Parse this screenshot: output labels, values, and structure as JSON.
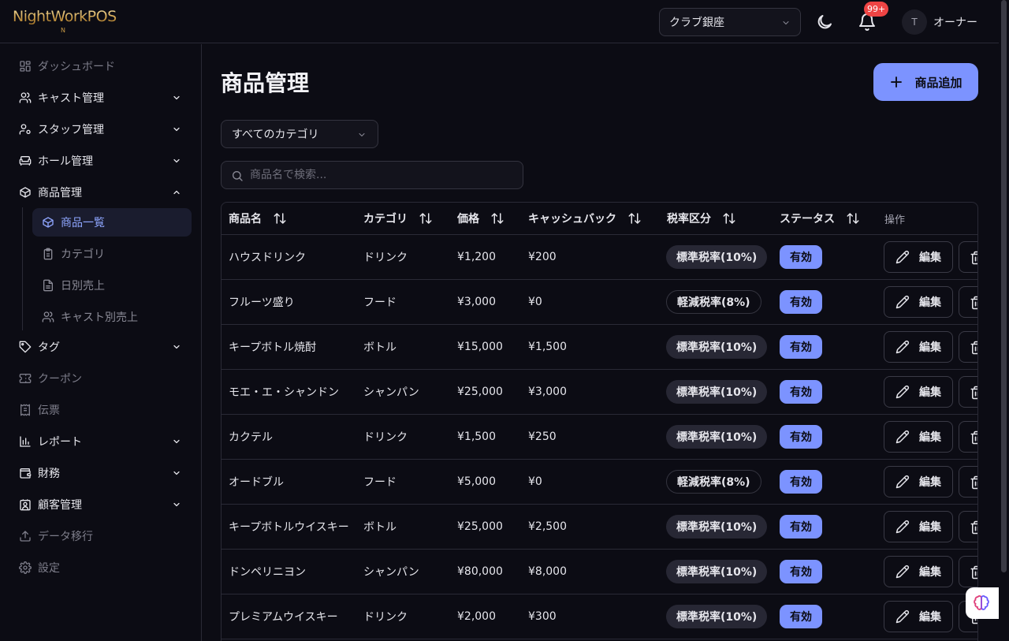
{
  "app": {
    "logo_text": "NightWorkPOS",
    "logo_mark": "N"
  },
  "header": {
    "store_select_value": "クラブ銀座",
    "notifications_badge": "99+",
    "avatar_initial": "T",
    "user_name": "オーナー"
  },
  "sidebar": {
    "items": [
      {
        "label": "ダッシュボード",
        "icon": "dashboard-icon"
      },
      {
        "label": "キャスト管理",
        "icon": "users-icon"
      },
      {
        "label": "スタッフ管理",
        "icon": "user-cog-icon"
      },
      {
        "label": "ホール管理",
        "icon": "sofa-icon"
      },
      {
        "label": "商品管理",
        "icon": "package-icon"
      },
      {
        "label": "タグ",
        "icon": "tag-icon"
      },
      {
        "label": "クーポン",
        "icon": "ticket-icon"
      },
      {
        "label": "伝票",
        "icon": "receipt-icon"
      },
      {
        "label": "レポート",
        "icon": "bar-chart-icon"
      },
      {
        "label": "財務",
        "icon": "wallet-icon"
      },
      {
        "label": "顧客管理",
        "icon": "contact-icon"
      },
      {
        "label": "データ移行",
        "icon": "upload-icon"
      },
      {
        "label": "設定",
        "icon": "gear-icon"
      }
    ],
    "sub_items": [
      {
        "label": "商品一覧",
        "icon": "package-icon"
      },
      {
        "label": "カテゴリ",
        "icon": "clipboard-icon"
      },
      {
        "label": "日別売上",
        "icon": "file-icon"
      },
      {
        "label": "キャスト別売上",
        "icon": "users-icon"
      }
    ]
  },
  "main": {
    "title": "商品管理",
    "add_button": "商品追加",
    "category_filter": "すべてのカテゴリ",
    "search_placeholder": "商品名で検索...",
    "columns": [
      "商品名",
      "カテゴリ",
      "価格",
      "キャッシュバック",
      "税率区分",
      "ステータス",
      "操作"
    ],
    "edit_label": "編集",
    "rows": [
      {
        "name": "ハウスドリンク",
        "category": "ドリンク",
        "price": "¥1,200",
        "cashback": "¥200",
        "tax": "標準税率(10%)",
        "tax_kind": "standard",
        "status": "有効"
      },
      {
        "name": "フルーツ盛り",
        "category": "フード",
        "price": "¥3,000",
        "cashback": "¥0",
        "tax": "軽減税率(8%)",
        "tax_kind": "reduced",
        "status": "有効"
      },
      {
        "name": "キープボトル焼酎",
        "category": "ボトル",
        "price": "¥15,000",
        "cashback": "¥1,500",
        "tax": "標準税率(10%)",
        "tax_kind": "standard",
        "status": "有効"
      },
      {
        "name": "モエ・エ・シャンドン",
        "category": "シャンパン",
        "price": "¥25,000",
        "cashback": "¥3,000",
        "tax": "標準税率(10%)",
        "tax_kind": "standard",
        "status": "有効"
      },
      {
        "name": "カクテル",
        "category": "ドリンク",
        "price": "¥1,500",
        "cashback": "¥250",
        "tax": "標準税率(10%)",
        "tax_kind": "standard",
        "status": "有効"
      },
      {
        "name": "オードブル",
        "category": "フード",
        "price": "¥5,000",
        "cashback": "¥0",
        "tax": "軽減税率(8%)",
        "tax_kind": "reduced",
        "status": "有効"
      },
      {
        "name": "キープボトルウイスキー",
        "category": "ボトル",
        "price": "¥25,000",
        "cashback": "¥2,500",
        "tax": "標準税率(10%)",
        "tax_kind": "standard",
        "status": "有効"
      },
      {
        "name": "ドンペリニヨン",
        "category": "シャンパン",
        "price": "¥80,000",
        "cashback": "¥8,000",
        "tax": "標準税率(10%)",
        "tax_kind": "standard",
        "status": "有効"
      },
      {
        "name": "プレミアムウイスキー",
        "category": "ドリンク",
        "price": "¥2,000",
        "cashback": "¥300",
        "tax": "標準税率(10%)",
        "tax_kind": "standard",
        "status": "有効"
      }
    ]
  },
  "colors": {
    "accent": "#7c93ff",
    "background": "#0c0c14",
    "badge": "#ef4444",
    "logo_gold": "#c99a45"
  }
}
